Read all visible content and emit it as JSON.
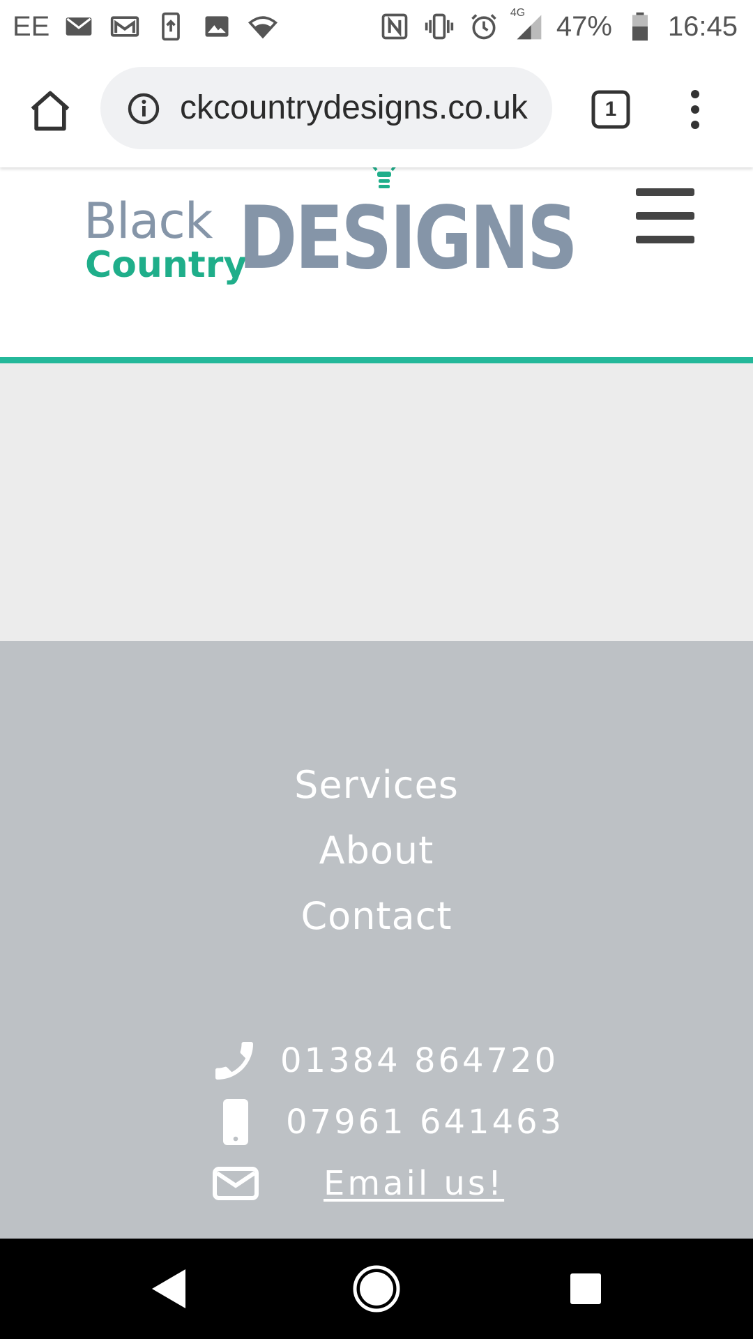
{
  "status_bar": {
    "carrier": "EE",
    "network": "4G",
    "battery": "47%",
    "time": "16:45",
    "left_icons": [
      "mail-icon",
      "gmail-icon",
      "upload-icon",
      "image-icon",
      "shield-icon"
    ],
    "right_icons": [
      "nfc-icon",
      "vibrate-icon",
      "alarm-icon",
      "signal-icon",
      "battery-icon"
    ]
  },
  "browser": {
    "url": "ckcountrydesigns.co.uk",
    "tab_count": "1"
  },
  "site": {
    "logo": {
      "word1": "Black",
      "word2": "Country",
      "word3": "DESIGNS"
    },
    "colors": {
      "accent": "#24b89a",
      "logo_grey": "#8595a8",
      "logo_green": "#1fae8a",
      "footer_bg": "#bdc1c5",
      "band_bg": "#ececec"
    }
  },
  "footer": {
    "nav": [
      "Services",
      "About",
      "Contact"
    ],
    "phone": "01384 864720",
    "mobile": "07961 641463",
    "email_label": "Email us!"
  }
}
